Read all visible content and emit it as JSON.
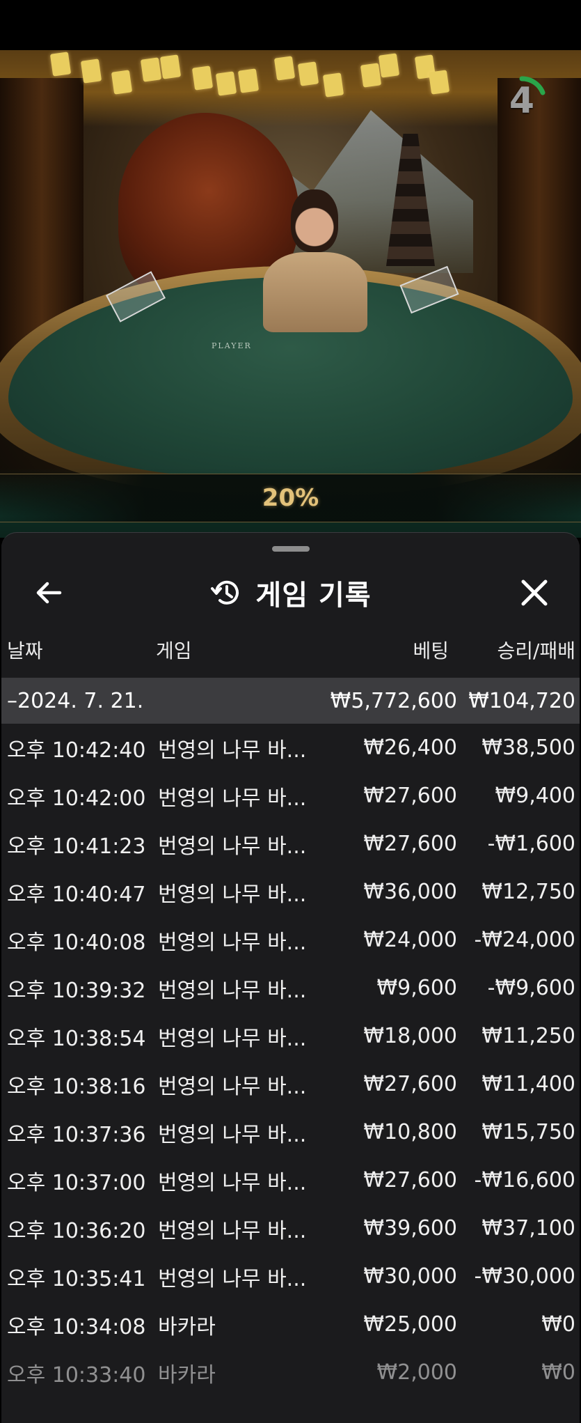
{
  "game_view": {
    "timer": "4",
    "promo_label": "20%",
    "table_player_label": "PLAYER"
  },
  "history": {
    "title": "게임 기록",
    "icons": {
      "back": "arrow-left-icon",
      "history": "history-icon",
      "close": "close-icon"
    },
    "columns": {
      "date": "날짜",
      "game": "게임",
      "bet": "베팅",
      "result": "승리/패배"
    },
    "summary": {
      "date": "–2024. 7. 21.",
      "bet": "₩5,772,600",
      "result": "₩104,720"
    },
    "rows": [
      {
        "time": "오후 10:42:40",
        "game": "번영의 나무 바...",
        "bet": "₩26,400",
        "result": "₩38,500"
      },
      {
        "time": "오후 10:42:00",
        "game": "번영의 나무 바...",
        "bet": "₩27,600",
        "result": "₩9,400"
      },
      {
        "time": "오후 10:41:23",
        "game": "번영의 나무 바...",
        "bet": "₩27,600",
        "result": "-₩1,600"
      },
      {
        "time": "오후 10:40:47",
        "game": "번영의 나무 바...",
        "bet": "₩36,000",
        "result": "₩12,750"
      },
      {
        "time": "오후 10:40:08",
        "game": "번영의 나무 바...",
        "bet": "₩24,000",
        "result": "-₩24,000"
      },
      {
        "time": "오후 10:39:32",
        "game": "번영의 나무 바...",
        "bet": "₩9,600",
        "result": "-₩9,600"
      },
      {
        "time": "오후 10:38:54",
        "game": "번영의 나무 바...",
        "bet": "₩18,000",
        "result": "₩11,250"
      },
      {
        "time": "오후 10:38:16",
        "game": "번영의 나무 바...",
        "bet": "₩27,600",
        "result": "₩11,400"
      },
      {
        "time": "오후 10:37:36",
        "game": "번영의 나무 바...",
        "bet": "₩10,800",
        "result": "₩15,750"
      },
      {
        "time": "오후 10:37:00",
        "game": "번영의 나무 바...",
        "bet": "₩27,600",
        "result": "-₩16,600"
      },
      {
        "time": "오후 10:36:20",
        "game": "번영의 나무 바...",
        "bet": "₩39,600",
        "result": "₩37,100"
      },
      {
        "time": "오후 10:35:41",
        "game": "번영의 나무 바...",
        "bet": "₩30,000",
        "result": "-₩30,000"
      },
      {
        "time": "오후 10:34:08",
        "game": "바카라",
        "bet": "₩25,000",
        "result": "₩0"
      },
      {
        "time": "오후 10:33:40",
        "game": "바카라",
        "bet": "₩2,000",
        "result": "₩0"
      }
    ]
  }
}
